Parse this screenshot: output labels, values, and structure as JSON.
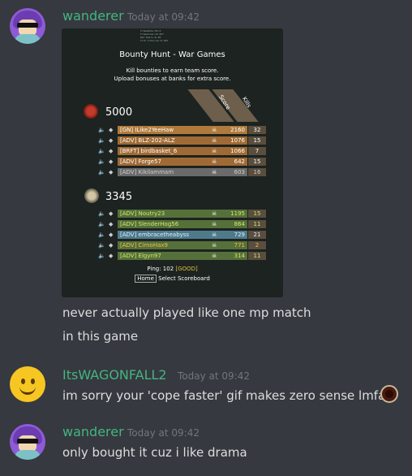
{
  "messages": [
    {
      "username": "wanderer",
      "username_color": "#43b581",
      "timestamp": "Today at 09:42",
      "lines": [
        "never actually played like one mp match",
        "in this game"
      ]
    },
    {
      "username": "ItsWAGONFALL2",
      "username_color": "#43b581",
      "timestamp": "Today at 09:42",
      "lines": [
        "im sorry your 'cope faster' gif makes zero sense lmfao"
      ]
    },
    {
      "username": "wanderer",
      "username_color": "#43b581",
      "timestamp": "Today at 09:42",
      "lines": [
        "only bought it cuz i like drama"
      ]
    }
  ],
  "game": {
    "title": "Bounty Hunt - War Games",
    "description_1": "Kill bounties to earn team score.",
    "description_2": "Upload bonuses at banks for extra score.",
    "col_score": "Score",
    "col_kills": "Kills",
    "team1": {
      "score": "5000",
      "players": [
        {
          "name": "[GN] ILike2YeeHaw",
          "score": "2160",
          "kills": "32",
          "color": "#b07a3a",
          "text": "#ffffff",
          "row_icon": "speaker"
        },
        {
          "name": "[ADV] BLZ-202-ALZ",
          "score": "1076",
          "kills": "15",
          "color": "#a06a34",
          "text": "#ffffff",
          "row_icon": "speaker"
        },
        {
          "name": "[BRFT] birdbasket_6",
          "score": "1066",
          "kills": "7",
          "color": "#a06a34",
          "text": "#ffffff",
          "row_icon": "speaker"
        },
        {
          "name": "[ADV] Forge57",
          "score": "642",
          "kills": "15",
          "color": "#a06a34",
          "text": "#ffffff",
          "row_icon": "speaker"
        },
        {
          "name": "[ADV] Kikilammam",
          "score": "603",
          "kills": "16",
          "color": "#6b6b6b",
          "text": "#cfcfcf",
          "row_icon": "speaker"
        }
      ]
    },
    "team2": {
      "score": "3345",
      "players": [
        {
          "name": "[ADV] Noutry23",
          "score": "1195",
          "kills": "15",
          "color": "#56703a",
          "text": "#cfe86b",
          "row_icon": "speaker"
        },
        {
          "name": "[ADV] SlenderHog56",
          "score": "864",
          "kills": "11",
          "color": "#56703a",
          "text": "#cfe86b",
          "row_icon": "speaker"
        },
        {
          "name": "[ADV] embracetheabyss",
          "score": "729",
          "kills": "21",
          "color": "#4f7a8c",
          "text": "#d9f0ff",
          "row_icon": "speaker"
        },
        {
          "name": "[ADV] CirnoHax9",
          "score": "771",
          "kills": "2",
          "color": "#56703a",
          "text": "#f0c040",
          "row_icon": "speaker"
        },
        {
          "name": "[ADV] Elgyn97",
          "score": "314",
          "kills": "11",
          "color": "#56703a",
          "text": "#cfe86b",
          "row_icon": "speaker"
        }
      ]
    },
    "ping_label": "Ping: 102",
    "ping_value": "[GOOD]",
    "footer_key": "Home",
    "footer_text": "Select Scoreboard"
  }
}
